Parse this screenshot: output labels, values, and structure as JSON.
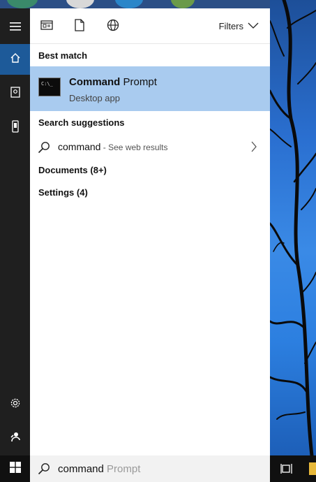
{
  "panel": {
    "filters_label": "Filters",
    "best_match": {
      "heading": "Best match",
      "app_name_bold": "Command",
      "app_name_rest": " Prompt",
      "app_type": "Desktop app"
    },
    "search_suggestions": {
      "heading": "Search suggestions",
      "query": "command",
      "hint": " - See web results"
    },
    "documents_label": "Documents (8+)",
    "settings_label": "Settings (4)"
  },
  "searchbox": {
    "typed": "command",
    "suggestion_ghost": " Prompt"
  },
  "rail": {
    "icons": [
      "hamburger-icon",
      "home-icon",
      "notebook-icon",
      "device-icon",
      "gear-icon",
      "feedback-icon"
    ]
  },
  "colors": {
    "selected_row": "#a9cbef",
    "rail_active": "#1d5a99",
    "rail_bg": "#1f1f1f"
  }
}
